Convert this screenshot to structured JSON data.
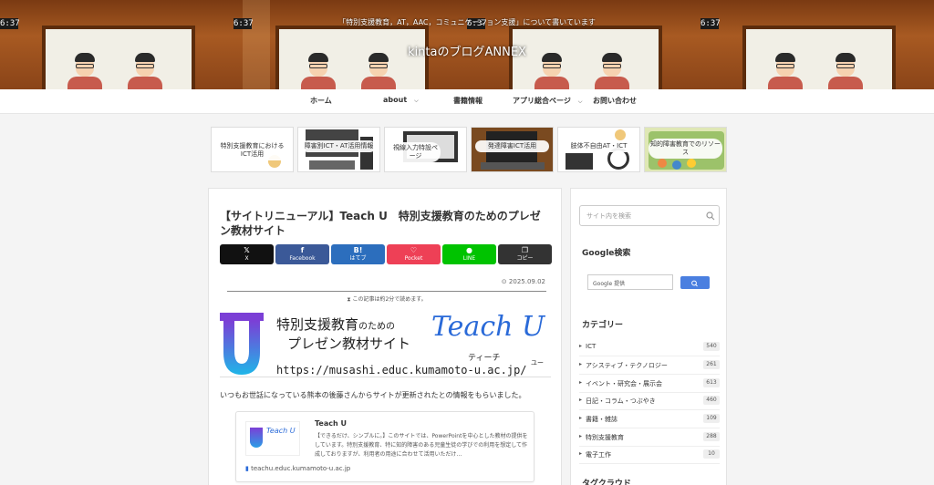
{
  "header": {
    "description": "「特別支援教育，AT，AAC，コミュニケーション支援」について書いています",
    "site_title": "kintaのブログANNEX",
    "clock_text": "6:37"
  },
  "nav": {
    "items": [
      {
        "label": "ホーム"
      },
      {
        "label": "about",
        "has_caret": true
      },
      {
        "label": "書籍情報"
      },
      {
        "label": "アプリ総合ページ",
        "has_caret": true
      },
      {
        "label": "お問い合わせ"
      }
    ]
  },
  "carousel": [
    {
      "label": "特別支援教育における ICT活用"
    },
    {
      "label": "障害別ICT・AT活用情報"
    },
    {
      "label": "視線入力特設ページ"
    },
    {
      "label": "発達障害ICT活用"
    },
    {
      "label": "肢体不自由AT・ICT"
    },
    {
      "label": "知的障害教育でのリソース"
    }
  ],
  "post": {
    "title": "【サイトリニューアル】Teach U　特別支援教育のためのプレゼン教材サイト",
    "share": [
      {
        "icon": "𝕏",
        "label": "X",
        "color": "#111111"
      },
      {
        "icon": "f",
        "label": "Facebook",
        "color": "#3b5998"
      },
      {
        "icon": "B!",
        "label": "はてブ",
        "color": "#2c6ebd"
      },
      {
        "icon": "♡",
        "label": "Pocket",
        "color": "#ee4056"
      },
      {
        "icon": "●",
        "label": "LINE",
        "color": "#00c300"
      },
      {
        "icon": "❐",
        "label": "コピー",
        "color": "#333333"
      }
    ],
    "date": "2025.09.02",
    "read_time": "この記事は約2分で読めます。",
    "banner": {
      "line1_main": "特別支援教育",
      "line1_small": "のための",
      "line2": "プレゼン教材サイト",
      "logo_text": "Teach U",
      "kana1": "ティーチ",
      "kana2": "ユー",
      "url": "https://musashi.educ.kumamoto-u.ac.jp/"
    },
    "intro": "いつもお世話になっている熊本の後藤さんからサイトが更新されたとの情報をもらいました。",
    "blogcard": {
      "thumb_text": "Teach U",
      "title": "Teach U",
      "description": "【できるだけ、シンプルに。】このサイトでは、PowerPointを中心とした教材の提供をしています。特別支援教育、特に知的障害のある児童生徒の学びでの利用を想定して作成しておりますが、利用者の用途に合わせて活用いただけ…",
      "url": "teachu.educ.kumamoto-u.ac.jp"
    }
  },
  "sidebar": {
    "search_placeholder": "サイト内を検索",
    "google_title": "Google検索",
    "google_box_text": "Google 提供",
    "categories_title": "カテゴリー",
    "categories": [
      {
        "name": "ICT",
        "count": "540"
      },
      {
        "name": "アシスティブ・テクノロジー",
        "count": "261"
      },
      {
        "name": "イベント・研究会・展示会",
        "count": "613"
      },
      {
        "name": "日記・コラム・つぶやき",
        "count": "460"
      },
      {
        "name": "書籍・雑誌",
        "count": "109"
      },
      {
        "name": "特別支援教育",
        "count": "288"
      },
      {
        "name": "電子工作",
        "count": "10"
      }
    ],
    "tagcloud_title": "タグクラウド"
  },
  "colors": {
    "header_brown": "#8a4418",
    "accent_blue": "#2a6ad8",
    "google_button": "#4a7fe0"
  }
}
